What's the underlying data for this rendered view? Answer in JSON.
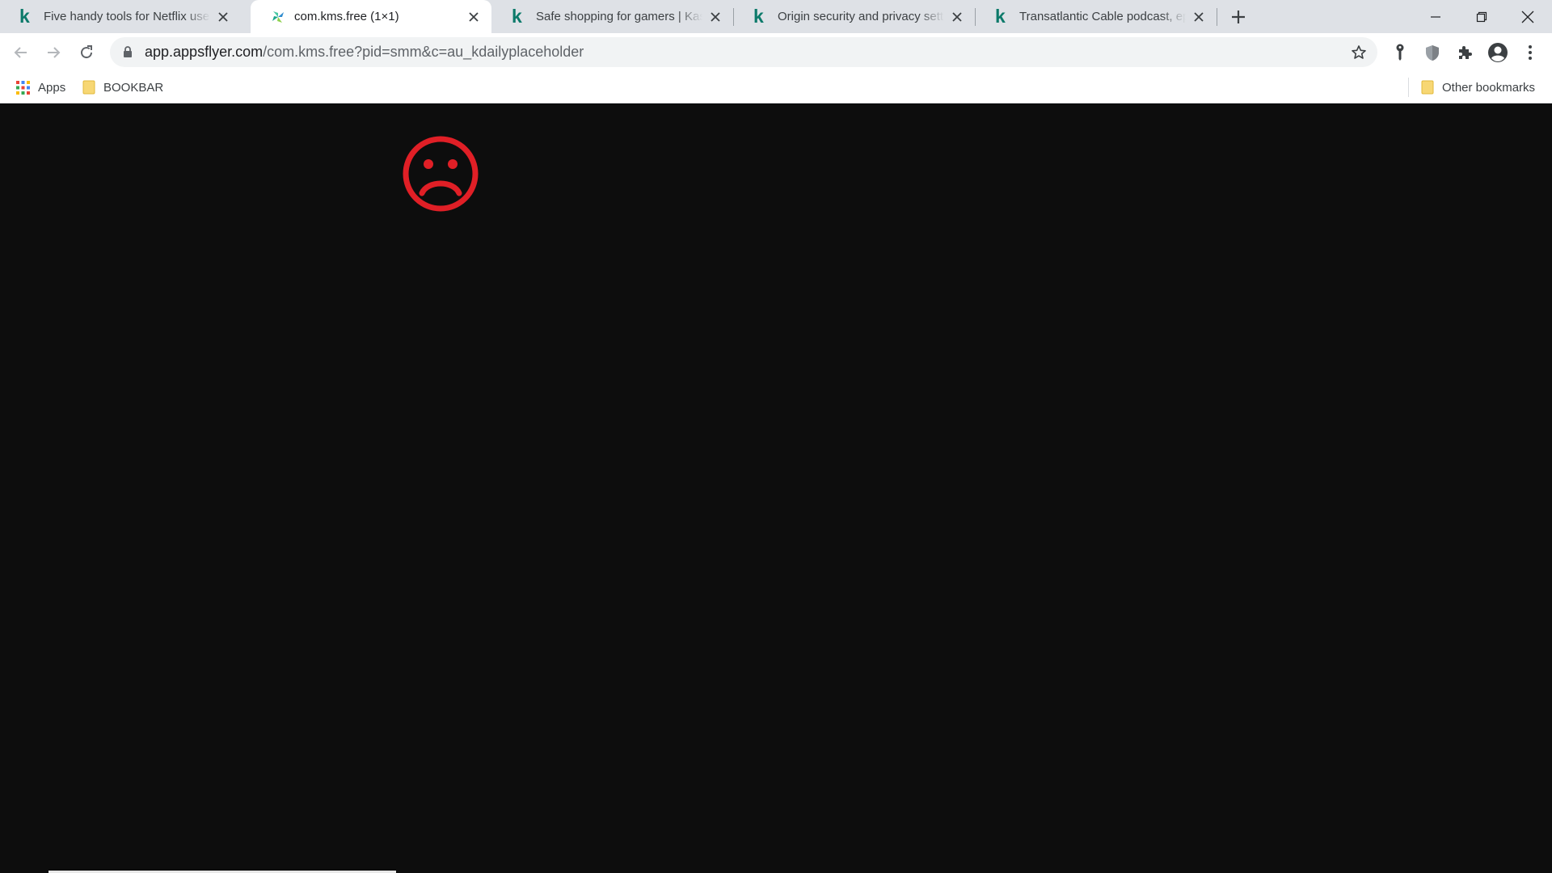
{
  "browser": {
    "tabs": [
      {
        "title": "Five handy tools for Netflix users",
        "favicon": "kaspersky-k-icon",
        "active": false
      },
      {
        "title": "com.kms.free (1×1)",
        "favicon": "appsflyer-icon",
        "active": true
      },
      {
        "title": "Safe shopping for gamers | Kaspersky",
        "favicon": "kaspersky-k-icon",
        "active": false
      },
      {
        "title": "Origin security and privacy settings",
        "favicon": "kaspersky-k-icon",
        "active": false
      },
      {
        "title": "Transatlantic Cable podcast, episode",
        "favicon": "kaspersky-k-icon",
        "active": false
      }
    ],
    "address": {
      "host": "app.appsflyer.com",
      "rest": "/com.kms.free?pid=smm&c=au_kdailyplaceholder"
    },
    "bookmarks": {
      "apps": "Apps",
      "folder": "BOOKBAR",
      "other": "Other bookmarks"
    }
  },
  "colors": {
    "page_background": "#0d0d0d",
    "sad_face": "#e01f26",
    "kaspersky_green": "#0c7a6a"
  },
  "page": {
    "icon": "sad-face-icon"
  }
}
